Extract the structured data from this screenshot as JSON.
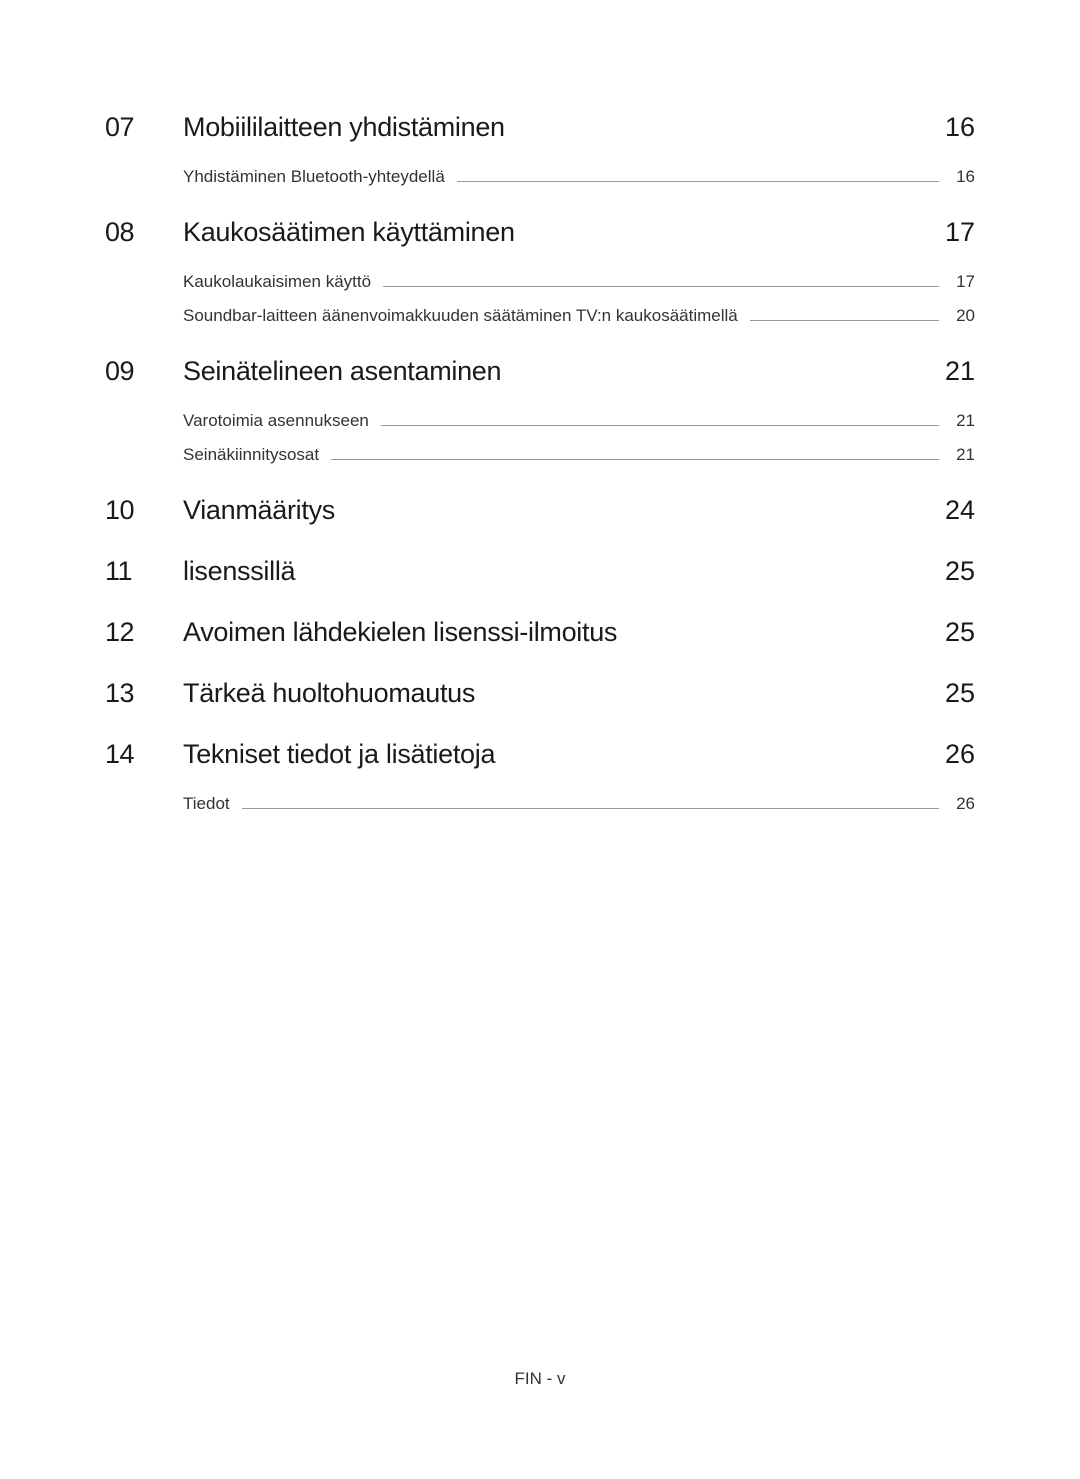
{
  "sections": [
    {
      "number": "07",
      "title": "Mobiililaitteen yhdistäminen",
      "page": "16",
      "subs": [
        {
          "title": "Yhdistäminen Bluetooth-yhteydellä",
          "page": "16"
        }
      ]
    },
    {
      "number": "08",
      "title": "Kaukosäätimen käyttäminen",
      "page": "17",
      "subs": [
        {
          "title": "Kaukolaukaisimen käyttö",
          "page": "17"
        },
        {
          "title": "Soundbar-laitteen äänenvoimakkuuden säätäminen TV:n kaukosäätimellä",
          "page": "20"
        }
      ]
    },
    {
      "number": "09",
      "title": "Seinätelineen asentaminen",
      "page": "21",
      "subs": [
        {
          "title": "Varotoimia asennukseen",
          "page": "21"
        },
        {
          "title": "Seinäkiinnitysosat",
          "page": "21"
        }
      ]
    },
    {
      "number": "10",
      "title": "Vianmääritys",
      "page": "24",
      "subs": []
    },
    {
      "number": "11",
      "title": "lisenssillä",
      "page": "25",
      "subs": []
    },
    {
      "number": "12",
      "title": "Avoimen lähdekielen lisenssi-ilmoitus",
      "page": "25",
      "subs": []
    },
    {
      "number": "13",
      "title": "Tärkeä huoltohuomautus",
      "page": "25",
      "subs": []
    },
    {
      "number": "14",
      "title": "Tekniset tiedot ja lisätietoja",
      "page": "26",
      "subs": [
        {
          "title": "Tiedot",
          "page": "26"
        }
      ]
    }
  ],
  "footer": "FIN - v"
}
